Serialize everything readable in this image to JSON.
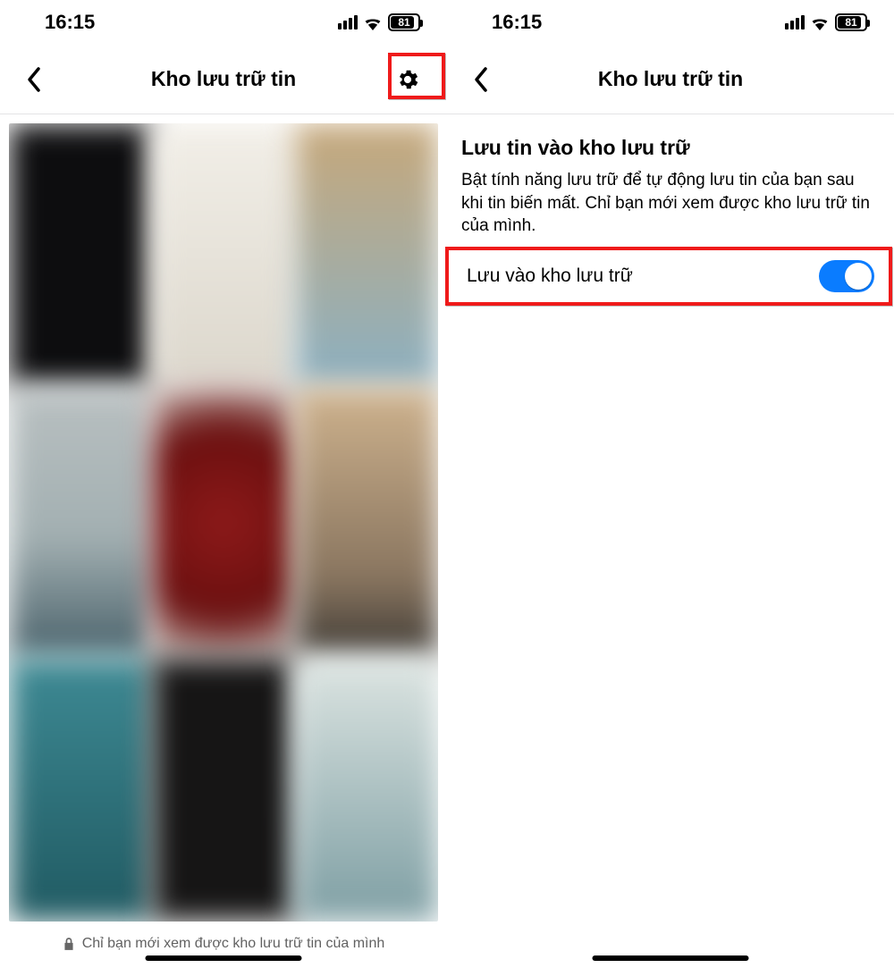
{
  "status": {
    "time": "16:15",
    "battery": "81"
  },
  "left": {
    "nav_title": "Kho lưu trữ tin",
    "footer": "Chỉ bạn mới xem được kho lưu trữ tin của mình"
  },
  "right": {
    "nav_title": "Kho lưu trữ tin",
    "section_title": "Lưu tin vào kho lưu trữ",
    "section_desc": "Bật tính năng lưu trữ để tự động lưu tin của bạn sau khi tin biến mất. Chỉ bạn mới xem được kho lưu trữ tin của mình.",
    "toggle_label": "Lưu vào kho lưu trữ",
    "toggle_on": true
  },
  "colors": {
    "highlight": "#ef1a1a",
    "switch_on": "#0a7cff"
  }
}
